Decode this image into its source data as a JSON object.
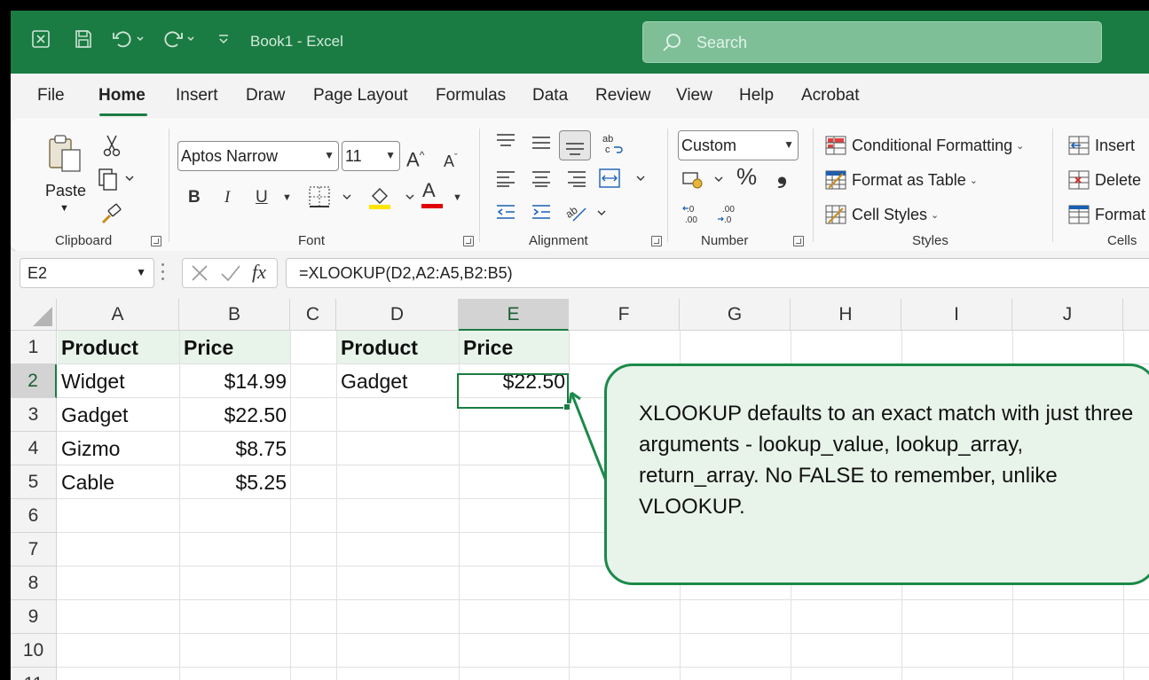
{
  "titlebar": {
    "doc_title": "Book1  -  Excel",
    "search_placeholder": "Search",
    "icons": [
      "autosave-icon",
      "save-icon",
      "undo-icon",
      "redo-icon",
      "customize-qat-icon",
      "search-icon"
    ]
  },
  "tabs": [
    "File",
    "Home",
    "Insert",
    "Draw",
    "Page Layout",
    "Formulas",
    "Data",
    "Review",
    "View",
    "Help",
    "Acrobat"
  ],
  "active_tab": "Home",
  "ribbon": {
    "clipboard": {
      "paste_label": "Paste",
      "group_label": "Clipboard"
    },
    "font": {
      "font_name": "Aptos Narrow",
      "font_size": "11",
      "group_label": "Font",
      "bold": "B",
      "italic": "I",
      "underline": "U",
      "grow": "A",
      "shrink": "A",
      "font_color_glyph": "A"
    },
    "alignment": {
      "group_label": "Alignment"
    },
    "number": {
      "format": "Custom",
      "group_label": "Number",
      "percent": "%",
      "comma": "❟"
    },
    "styles": {
      "conditional_formatting": "Conditional Formatting",
      "format_as_table": "Format as Table",
      "cell_styles": "Cell Styles",
      "group_label": "Styles"
    },
    "cells": {
      "insert": "Insert",
      "delete": "Delete",
      "format": "Format",
      "group_label": "Cells"
    }
  },
  "formula_bar": {
    "name_box": "E2",
    "fx": "fx",
    "formula": "=XLOOKUP(D2,A2:A5,B2:B5)"
  },
  "grid": {
    "columns": [
      "A",
      "B",
      "C",
      "D",
      "E",
      "F",
      "G",
      "H",
      "I",
      "J"
    ],
    "rows": [
      "1",
      "2",
      "3",
      "4",
      "5",
      "6",
      "7",
      "8",
      "9",
      "10",
      "11"
    ],
    "selected_cell": "E2",
    "cells": {
      "A1": "Product",
      "B1": "Price",
      "D1": "Product",
      "E1": "Price",
      "A2": "Widget",
      "B2": "$14.99",
      "D2": "Gadget",
      "E2": "$22.50",
      "A3": "Gadget",
      "B3": "$22.50",
      "A4": "Gizmo",
      "B4": "$8.75",
      "A5": "Cable",
      "B5": "$5.25"
    }
  },
  "callout": {
    "text": "XLOOKUP defaults to an exact match with just three arguments - lookup_value, lookup_array, return_array. No FALSE to remember, unlike VLOOKUP."
  },
  "colors": {
    "excel_green": "#1b7c43",
    "header_fill": "#e8f3ea",
    "callout_border": "#1b8a4a"
  }
}
